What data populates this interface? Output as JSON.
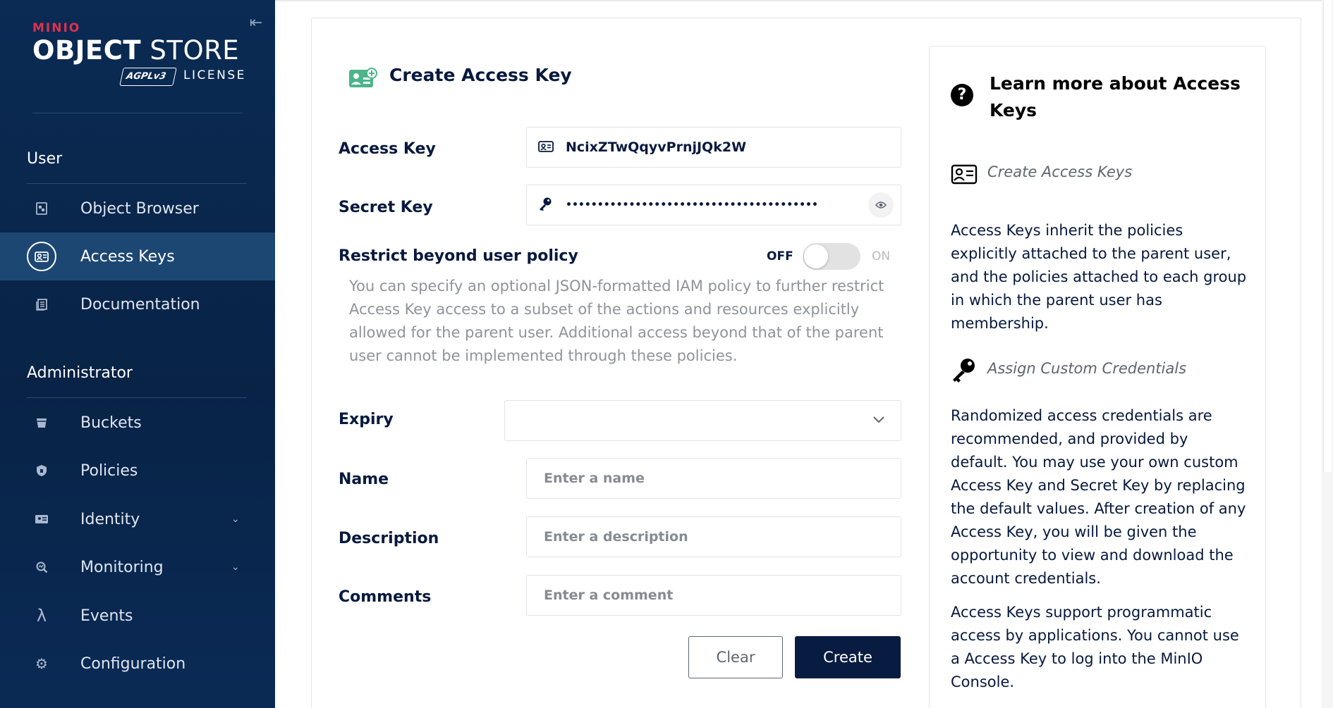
{
  "brand": {
    "product": "MINIO",
    "title_bold": "OBJECT",
    "title_rest": " STORE",
    "license_badge": "AGPLv3",
    "license_label": "LICENSE"
  },
  "sidebar": {
    "collapse_icon": "collapse-left-icon",
    "sections": [
      {
        "title": "User",
        "items": [
          {
            "label": "Object Browser",
            "icon": "object-browser-icon",
            "active": false
          },
          {
            "label": "Access Keys",
            "icon": "access-keys-icon",
            "active": true
          },
          {
            "label": "Documentation",
            "icon": "documentation-icon",
            "active": false
          }
        ]
      },
      {
        "title": "Administrator",
        "items": [
          {
            "label": "Buckets",
            "icon": "bucket-icon",
            "active": false
          },
          {
            "label": "Policies",
            "icon": "policy-icon",
            "active": false
          },
          {
            "label": "Identity",
            "icon": "identity-icon",
            "active": false,
            "expandable": true
          },
          {
            "label": "Monitoring",
            "icon": "monitoring-icon",
            "active": false,
            "expandable": true
          },
          {
            "label": "Events",
            "icon": "lambda-icon",
            "active": false
          },
          {
            "label": "Configuration",
            "icon": "gear-icon",
            "active": false
          }
        ]
      }
    ]
  },
  "form": {
    "title": "Create Access Key",
    "access_key": {
      "label": "Access Key",
      "value": "NcixZTwQqyvPrnjJQk2W"
    },
    "secret_key": {
      "label": "Secret Key",
      "value": "••••••••••••••••••••••••••••••••••••••••"
    },
    "restrict": {
      "label": "Restrict beyond user policy",
      "off_label": "OFF",
      "on_label": "ON",
      "enabled": false,
      "help": "You can specify an optional JSON-formatted IAM policy to further restrict Access Key access to a subset of the actions and resources explicitly allowed for the parent user. Additional access beyond that of the parent user cannot be implemented through these policies."
    },
    "expiry": {
      "label": "Expiry",
      "value": ""
    },
    "name": {
      "label": "Name",
      "placeholder": "Enter a name",
      "value": ""
    },
    "description": {
      "label": "Description",
      "placeholder": "Enter a description",
      "value": ""
    },
    "comments": {
      "label": "Comments",
      "placeholder": "Enter a comment",
      "value": ""
    },
    "clear_label": "Clear",
    "create_label": "Create"
  },
  "help": {
    "title": "Learn more about Access Keys",
    "create_heading": "Create Access Keys",
    "create_para": "Access Keys inherit the policies explicitly attached to the parent user, and the policies attached to each group in which the parent user has membership.",
    "custom_heading": "Assign Custom Credentials",
    "custom_para": "Randomized access credentials are recommended, and provided by default. You may use your own custom Access Key and Secret Key by replacing the default values. After creation of any Access Key, you will be given the opportunity to view and download the account credentials.",
    "programmatic_para": "Access Keys support programmatic access by applications. You cannot use a Access Key to log into the MinIO Console."
  },
  "colors": {
    "sidebar_bg": "#082346",
    "active_item_bg": "#1d4773",
    "primary_button": "#081c42",
    "brand_red": "#e0304e",
    "title_icon_green": "#4cb58a"
  }
}
